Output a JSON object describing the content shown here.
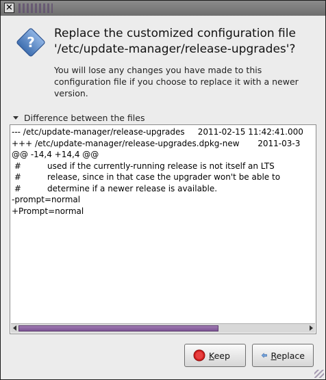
{
  "window": {
    "close_glyph": "✕"
  },
  "dialog": {
    "heading_line1": "Replace the customized configuration file",
    "heading_line2": "'/etc/update-manager/release-upgrades'?",
    "message_lines": [
      "You will lose any changes you have made to this",
      "configuration file if you choose to replace it with a newer",
      "version."
    ],
    "icon": "question-icon"
  },
  "diff": {
    "expander_label": "Difference between the files",
    "lines": [
      "--- /etc/update-manager/release-upgrades     2011-02-15 11:42:41.000",
      "+++ /etc/update-manager/release-upgrades.dpkg-new       2011-03-3",
      "@@ -14,4 +14,4 @@",
      " #          used if the currently-running release is not itself an LTS",
      " #          release, since in that case the upgrader won't be able to",
      " #          determine if a newer release is available.",
      "-prompt=normal",
      "+Prompt=normal"
    ],
    "scroll_position": 0.0
  },
  "buttons": {
    "keep": {
      "mnemonic": "K",
      "rest": "eep",
      "icon": "stop-icon"
    },
    "replace": {
      "mnemonic": "R",
      "rest": "eplace",
      "icon": "replace-arrow-icon"
    }
  },
  "colors": {
    "accent": "#7c5494",
    "icon_blue": "#4a78b8",
    "stop_red": "#d42020"
  }
}
